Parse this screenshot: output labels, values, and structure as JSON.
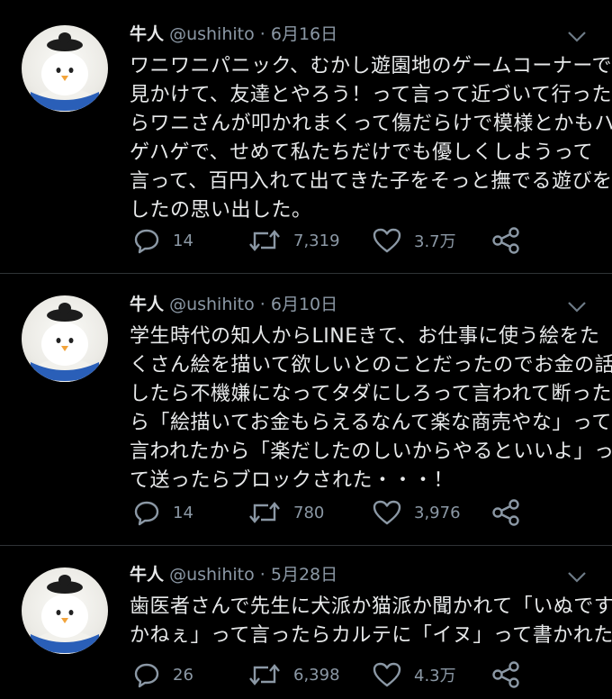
{
  "colors": {
    "background": "#000000",
    "text": "#e7e9ea",
    "secondary": "#8b98a5",
    "divider": "#2f3336",
    "avatar_band": "#2a5fb8"
  },
  "tweets": [
    {
      "name": "牛人",
      "handle": "@ushihito",
      "separator": "·",
      "date": "6月16日",
      "lines": [
        "ワニワニパニック、むかし遊園地のゲームコーナーで",
        "見かけて、友達とやろう！って言って近づいて行った",
        "らワニさんが叩かれまくって傷だらけで模様とかもハ",
        "ゲハゲで、せめて私たちだけでも優しくしようって",
        "言って、百円入れて出てきた子をそっと撫でる遊びを",
        "したの思い出した。"
      ],
      "replies": "14",
      "retweets": "7,319",
      "likes": "3.7万",
      "icons": [
        "reply-icon",
        "retweet-icon",
        "like-icon",
        "share-icon"
      ]
    },
    {
      "name": "牛人",
      "handle": "@ushihito",
      "separator": "·",
      "date": "6月10日",
      "lines": [
        "学生時代の知人からLINEきて、お仕事に使う絵をた",
        "くさん絵を描いて欲しいとのことだったのでお金の話",
        "したら不機嫌になってタダにしろって言われて断った",
        "ら「絵描いてお金もらえるなんて楽な商売やな」って",
        "言われたから「楽だしたのしいからやるといいよ」っ",
        "て送ったらブロックされた・・・！"
      ],
      "replies": "14",
      "retweets": "780",
      "likes": "3,976",
      "icons": [
        "reply-icon",
        "retweet-icon",
        "like-icon",
        "share-icon"
      ]
    },
    {
      "name": "牛人",
      "handle": "@ushihito",
      "separator": "·",
      "date": "5月28日",
      "lines": [
        "歯医者さんで先生に犬派か猫派か聞かれて「いぬです",
        "かねぇ」って言ったらカルテに「イヌ」って書かれた"
      ],
      "replies": "26",
      "retweets": "6,398",
      "likes": "4.3万",
      "icons": [
        "reply-icon",
        "retweet-icon",
        "like-icon",
        "share-icon"
      ]
    }
  ]
}
